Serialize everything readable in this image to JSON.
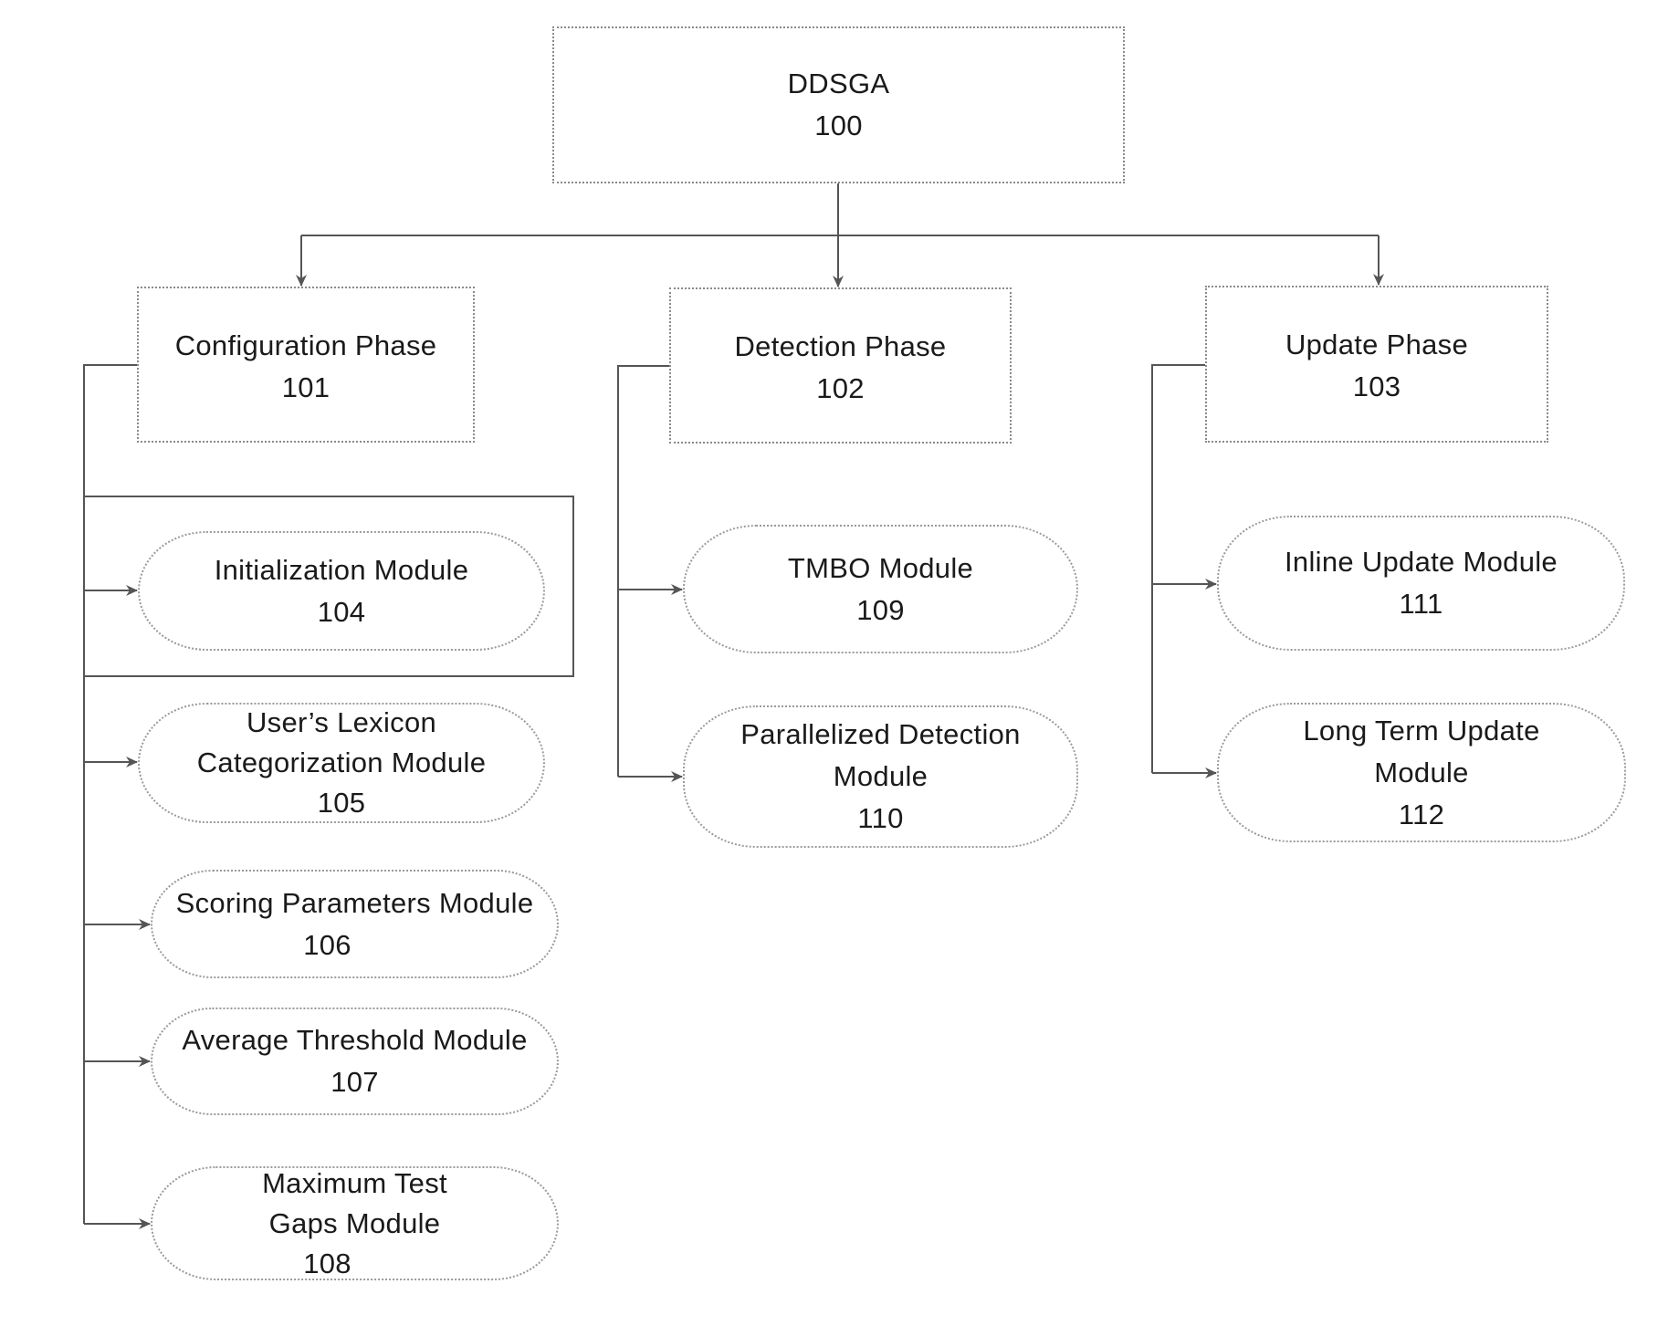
{
  "diagram": {
    "root": {
      "id": "100",
      "title": "DDSGA",
      "ref": "100"
    },
    "phases": [
      {
        "title": "Configuration Phase",
        "ref": "101",
        "modules": [
          {
            "lines": [
              "Initialization Module"
            ],
            "ref": "104",
            "framed": true
          },
          {
            "lines": [
              "User’s Lexicon",
              "Categorization Module"
            ],
            "ref": "105"
          },
          {
            "lines": [
              "Scoring Parameters Module"
            ],
            "ref": "106"
          },
          {
            "lines": [
              "Average Threshold Module"
            ],
            "ref": "107"
          },
          {
            "lines": [
              "Maximum Test",
              "Gaps Module"
            ],
            "ref": "108"
          }
        ]
      },
      {
        "title": "Detection Phase",
        "ref": "102",
        "modules": [
          {
            "lines": [
              "TMBO Module"
            ],
            "ref": "109"
          },
          {
            "lines": [
              "Parallelized Detection",
              "Module"
            ],
            "ref": "110"
          }
        ]
      },
      {
        "title": "Update Phase",
        "ref": "103",
        "modules": [
          {
            "lines": [
              "Inline Update Module"
            ],
            "ref": "111"
          },
          {
            "lines": [
              "Long Term Update",
              "Module"
            ],
            "ref": "112"
          }
        ]
      }
    ],
    "colors": {
      "line": "#555555",
      "border": "#8a8a8a",
      "text": "#1a1a1a",
      "background": "#ffffff"
    }
  }
}
